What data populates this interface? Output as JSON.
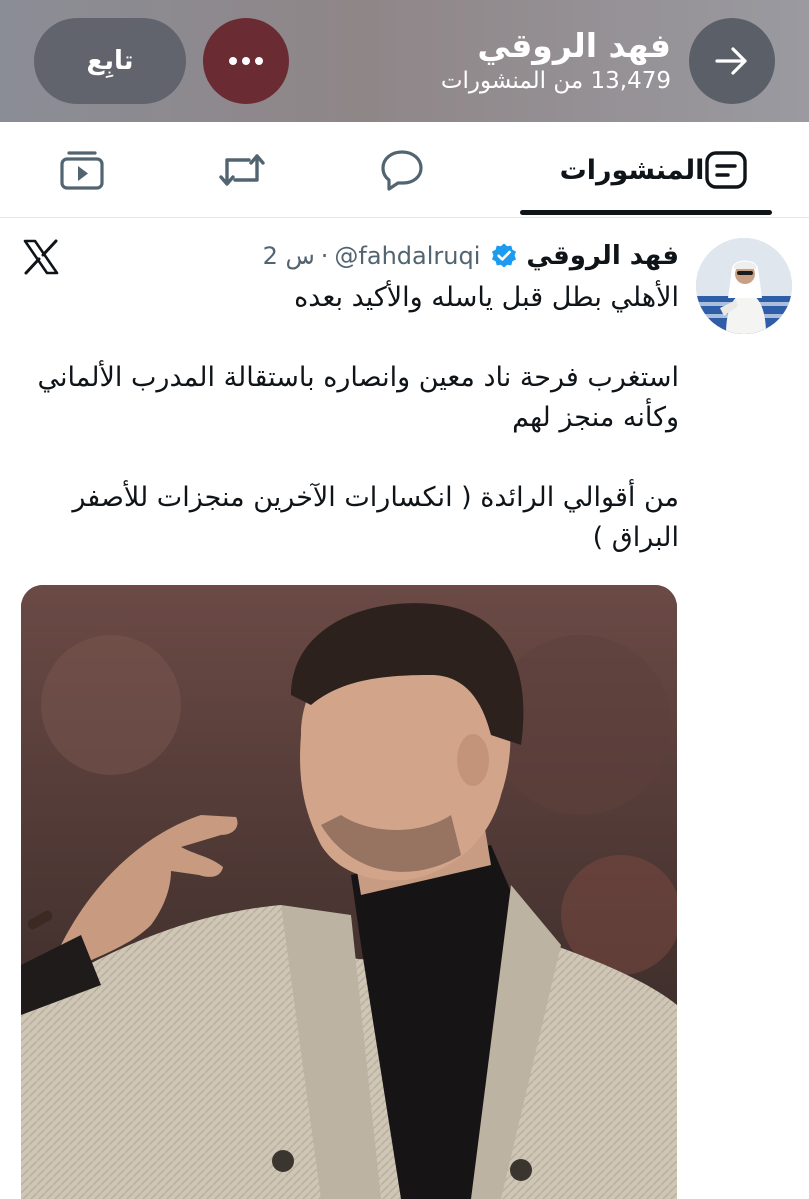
{
  "header": {
    "name": "فهد الروقي",
    "posts_count": "13,479 من المنشورات",
    "follow_label": "تابِع",
    "more_icon": "more-dots-icon",
    "back_icon": "arrow-right-icon",
    "colors": {
      "more_button": "#6a2b33",
      "back_button": "#5b6068"
    }
  },
  "tabs": {
    "items": [
      {
        "id": "posts",
        "label": "المنشورات",
        "icon": "posts-icon",
        "active": true
      },
      {
        "id": "replies",
        "label": "",
        "icon": "reply-bubble-icon",
        "active": false
      },
      {
        "id": "reposts",
        "label": "",
        "icon": "repost-icon",
        "active": false
      },
      {
        "id": "media",
        "label": "",
        "icon": "video-icon",
        "active": false
      }
    ]
  },
  "post": {
    "author_name": "فهد الروقي",
    "handle": "@fahdalruqi",
    "dot": "·",
    "time": "2 س",
    "verified_color": "#1d9bf0",
    "source_icon": "x-logo-icon",
    "paragraphs": [
      "الأهلي بطل قبل ياسله والأكيد بعده",
      "استغرب فرحة ناد معين وانصاره باستقالة المدرب الألماني وكأنه منجز لهم",
      "من أقوالي الرائدة ( انكسارات الآخرين منجزات للأصفر البراق )"
    ],
    "media_description_icon": "photo-coach-gesture"
  }
}
